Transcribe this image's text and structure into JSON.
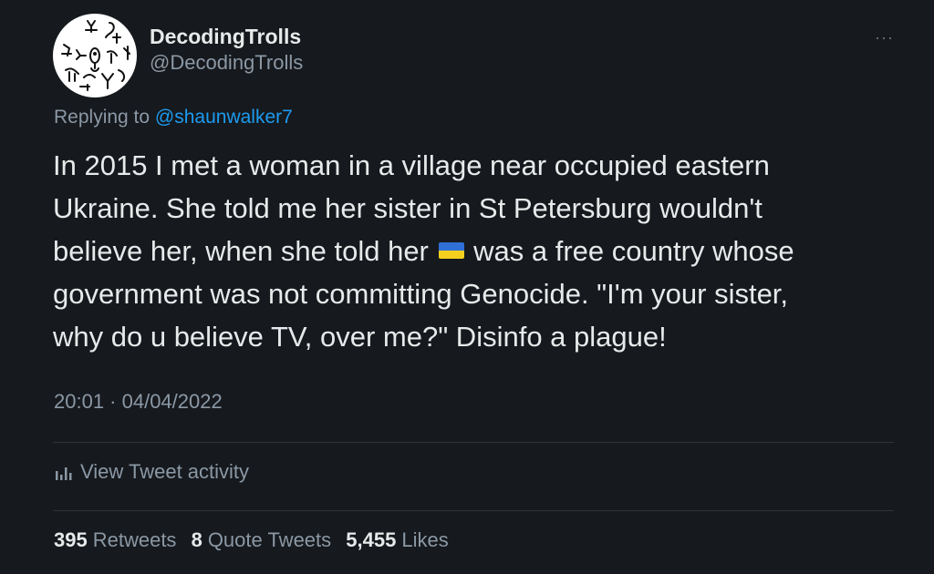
{
  "author": {
    "display_name": "DecodingTrolls",
    "handle": "@DecodingTrolls",
    "avatar_icon": "rock-art-avatar-icon"
  },
  "more_label": "···",
  "reply": {
    "prefix": "Replying to ",
    "mention": "@shaunwalker7"
  },
  "tweet": {
    "line1": "In 2015 I met a woman in a village near occupied eastern",
    "line2": "Ukraine. She told me her sister in St Petersburg wouldn't",
    "line3_before": "believe her, when she told her ",
    "line3_after": " was a free country whose",
    "line4": "government was not committing Genocide. \"I'm your sister,",
    "line5": "why do u believe TV, over me?\" Disinfo a plague!",
    "flag_icon": "ukraine-flag-icon"
  },
  "timestamp": "20:01 · 04/04/2022",
  "activity_label": "View Tweet activity",
  "stats": {
    "retweets_count": "395",
    "retweets_label": "Retweets",
    "quotes_count": "8",
    "quotes_label": "Quote Tweets",
    "likes_count": "5,455",
    "likes_label": "Likes"
  },
  "colors": {
    "background": "#16191d",
    "link": "#1d9bf0",
    "secondary_text": "#8b98a5",
    "primary_text": "#e7e9ea"
  }
}
